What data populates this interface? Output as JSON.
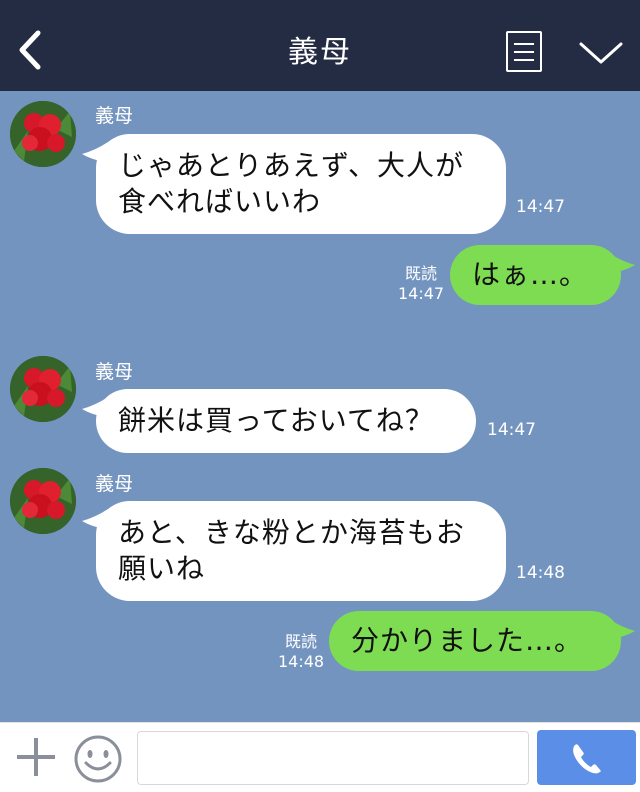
{
  "header": {
    "title": "義母",
    "back_icon": "chevron-left-icon",
    "menu_icon": "list-icon",
    "collapse_icon": "chevron-down-icon",
    "bg_color": "#232c42"
  },
  "chat": {
    "bg_color": "#7494c0",
    "messages": [
      {
        "direction": "in",
        "sender": "義母",
        "lines": [
          "じゃあとりあえず、大人が",
          "食べればいいわ"
        ],
        "time": "14:47"
      },
      {
        "direction": "out",
        "read": "既読",
        "text": "はぁ…。",
        "time": "14:47"
      },
      {
        "direction": "in",
        "sender": "義母",
        "lines": [
          "餅米は買っておいてね？"
        ],
        "time": "14:47"
      },
      {
        "direction": "in",
        "sender": "義母",
        "lines": [
          "あと、きな粉とか海苔もお",
          "願いね"
        ],
        "time": "14:48"
      },
      {
        "direction": "out",
        "read": "既読",
        "text": "分かりました…。",
        "time": "14:48"
      }
    ]
  },
  "footer": {
    "plus_icon": "plus-icon",
    "emoji_icon": "smiley-icon",
    "input_value": "",
    "input_placeholder": "",
    "call_icon": "phone-icon",
    "accent_color": "#5b8ee6"
  },
  "colors": {
    "incoming_bubble": "#ffffff",
    "outgoing_bubble": "#7edc52"
  }
}
